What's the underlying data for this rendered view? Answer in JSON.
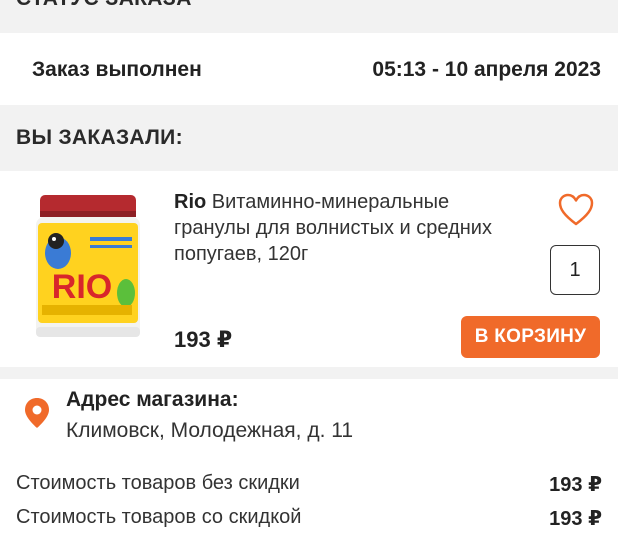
{
  "headers": {
    "status": "СТАТУС ЗАКАЗА",
    "ordered": "ВЫ ЗАКАЗАЛИ:"
  },
  "status": {
    "text": "Заказ выполнен",
    "datetime": "05:13 - 10 апреля 2023"
  },
  "product": {
    "brand": "Rio",
    "name": "Витаминно-минеральные гранулы для волнистых и средних попугаев, 120г",
    "quantity": "1",
    "price": "193 ₽",
    "cart_label": "В КОРЗИНУ",
    "image_text": "RIO",
    "favorite_icon": "heart-outline-icon"
  },
  "store": {
    "label": "Адрес магазина:",
    "address": "Климовск, Молодежная, д. 11",
    "icon": "location-pin-icon"
  },
  "costs": [
    {
      "label": "Стоимость товаров без скидки",
      "value": "193 ₽"
    },
    {
      "label": "Стоимость товаров со скидкой",
      "value": "193 ₽"
    }
  ],
  "colors": {
    "accent": "#f06a2a",
    "section_bg": "#f2f2f2"
  }
}
